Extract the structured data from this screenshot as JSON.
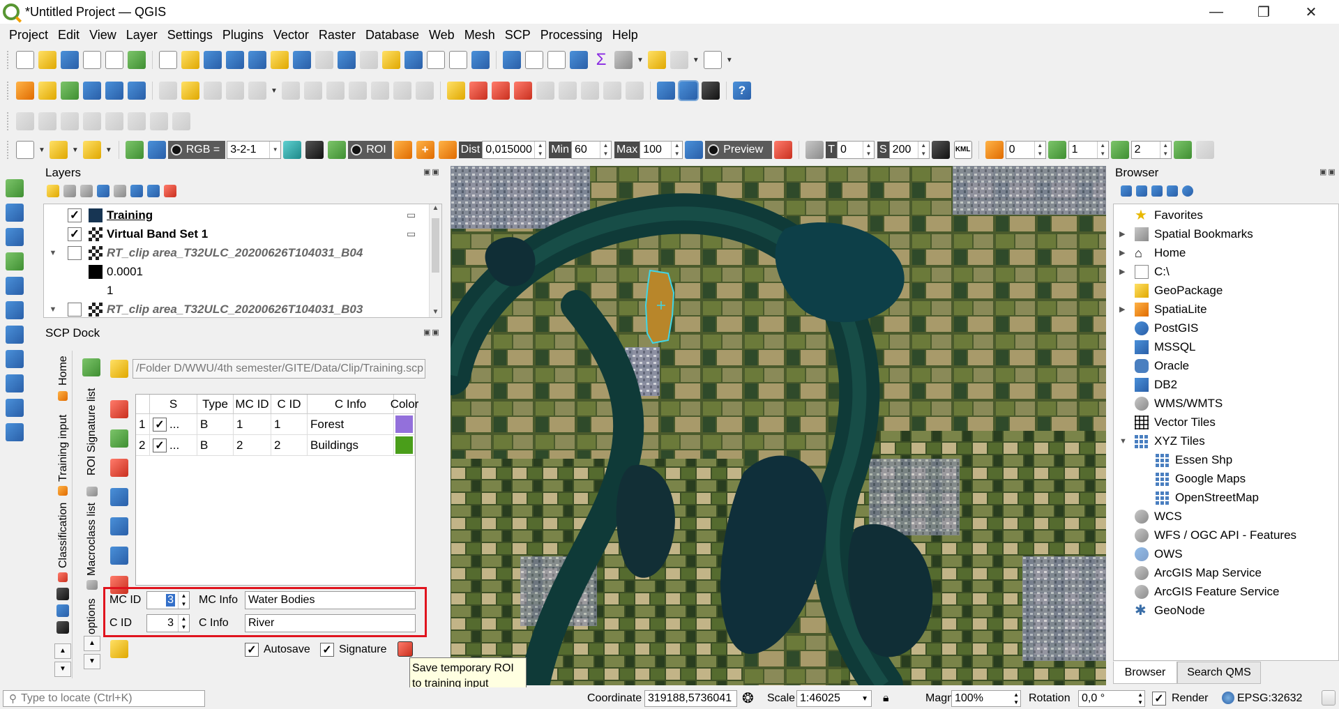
{
  "window": {
    "title": "*Untitled Project — QGIS",
    "controls": {
      "minimize": "—",
      "restore": "❐",
      "close": "✕"
    }
  },
  "menu": [
    "Project",
    "Edit",
    "View",
    "Layer",
    "Settings",
    "Plugins",
    "Vector",
    "Raster",
    "Database",
    "Web",
    "Mesh",
    "SCP",
    "Processing",
    "Help"
  ],
  "scp_toolbar": {
    "rgb_label": "RGB =",
    "rgb_value": "3-2-1",
    "roi_label": "ROI",
    "dist_label": "Dist",
    "dist_value": "0,015000",
    "min_label": "Min",
    "min_value": "60",
    "max_label": "Max",
    "max_value": "100",
    "preview_label": "Preview",
    "t_label": "T",
    "t_value": "0",
    "s_label": "S",
    "s_value": "200",
    "kml_label": "KML",
    "v1": "0",
    "v2": "1",
    "v3": "2"
  },
  "layers_panel": {
    "title": "Layers",
    "items": [
      {
        "name": "Training",
        "checked": true,
        "bold": true,
        "underline": true,
        "swatch": "#173553"
      },
      {
        "name": "Virtual Band Set 1",
        "checked": true,
        "bold": true
      },
      {
        "name": "RT_clip area_T32ULC_20200626T104031_B04",
        "checked": false,
        "italic": true
      },
      {
        "legend_min": "0.0001",
        "legend_max": "1"
      },
      {
        "name": "RT_clip area_T32ULC_20200626T104031_B03",
        "checked": false,
        "italic": true
      }
    ]
  },
  "scp_dock": {
    "title": "SCP Dock",
    "vertical_tabs": {
      "home": "Home",
      "training_input": "Training input",
      "classification": "Classification",
      "options": "options"
    },
    "sub_tabs": {
      "roi_signature": "ROI Signature list",
      "macroclass": "Macroclass list"
    },
    "path": "/Folder D/WWU/4th semester/GITE/Data/Clip/Training.scp",
    "table": {
      "headers": [
        "S",
        "Type",
        "MC ID",
        "C ID",
        "C Info",
        "Color"
      ],
      "rows": [
        {
          "num": "1",
          "dots": "...",
          "type": "B",
          "mc_id": "1",
          "c_id": "1",
          "c_info": "Forest",
          "color": "#9370db"
        },
        {
          "num": "2",
          "dots": "...",
          "type": "B",
          "mc_id": "2",
          "c_id": "2",
          "c_info": "Buildings",
          "color": "#4a9e1a"
        }
      ]
    },
    "mc_id_label": "MC ID",
    "mc_id_value": "3",
    "mc_info_label": "MC Info",
    "mc_info_value": "Water Bodies",
    "c_id_label": "C ID",
    "c_id_value": "3",
    "c_info_label": "C Info",
    "c_info_value": "River",
    "autosave_label": "Autosave",
    "signature_label": "Signature",
    "tooltip_line1": "Save temporary ROI",
    "tooltip_line2": "to training input"
  },
  "browser": {
    "title": "Browser",
    "items": [
      {
        "label": "Favorites",
        "icon": "star-icon",
        "exp": ""
      },
      {
        "label": "Spatial Bookmarks",
        "icon": "bookmark-icon",
        "exp": "▶"
      },
      {
        "label": "Home",
        "icon": "home-icon",
        "exp": "▶"
      },
      {
        "label": "C:\\",
        "icon": "folder-icon",
        "exp": "▶"
      },
      {
        "label": "GeoPackage",
        "icon": "geopackage-icon",
        "exp": ""
      },
      {
        "label": "SpatiaLite",
        "icon": "spatialite-icon",
        "exp": "▶"
      },
      {
        "label": "PostGIS",
        "icon": "postgis-icon",
        "exp": ""
      },
      {
        "label": "MSSQL",
        "icon": "mssql-icon",
        "exp": ""
      },
      {
        "label": "Oracle",
        "icon": "oracle-icon",
        "exp": ""
      },
      {
        "label": "DB2",
        "icon": "db2-icon",
        "exp": ""
      },
      {
        "label": "WMS/WMTS",
        "icon": "globe-icon",
        "exp": ""
      },
      {
        "label": "Vector Tiles",
        "icon": "grid-icon",
        "exp": ""
      },
      {
        "label": "XYZ Tiles",
        "icon": "grid-icon",
        "exp": "▼"
      },
      {
        "label": "Essen Shp",
        "icon": "grid-icon",
        "exp": "",
        "indent": true
      },
      {
        "label": "Google Maps",
        "icon": "grid-icon",
        "exp": "",
        "indent": true
      },
      {
        "label": "OpenStreetMap",
        "icon": "grid-icon",
        "exp": "",
        "indent": true
      },
      {
        "label": "WCS",
        "icon": "globe-icon",
        "exp": ""
      },
      {
        "label": "WFS / OGC API - Features",
        "icon": "globe-icon",
        "exp": ""
      },
      {
        "label": "OWS",
        "icon": "globe-icon",
        "exp": ""
      },
      {
        "label": "ArcGIS Map Service",
        "icon": "globe-icon",
        "exp": ""
      },
      {
        "label": "ArcGIS Feature Service",
        "icon": "globe-icon",
        "exp": ""
      },
      {
        "label": "GeoNode",
        "icon": "geonode-icon",
        "exp": ""
      }
    ],
    "tabs": [
      "Browser",
      "Search QMS"
    ]
  },
  "status": {
    "locate_placeholder": "Type to locate (Ctrl+K)",
    "coordinate_label": "Coordinate",
    "coordinate_value": "319188,5736041",
    "scale_label": "Scale",
    "scale_value": "1:46025",
    "magnifier_label": "Magnifier",
    "magnifier_value": "100%",
    "rotation_label": "Rotation",
    "rotation_value": "0,0 °",
    "render_label": "Render",
    "epsg": "EPSG:32632"
  },
  "colors": {
    "accent_highlight": "#e0141e",
    "roi_fill": "#b8862a",
    "roi_outline": "#3fd6e8"
  }
}
